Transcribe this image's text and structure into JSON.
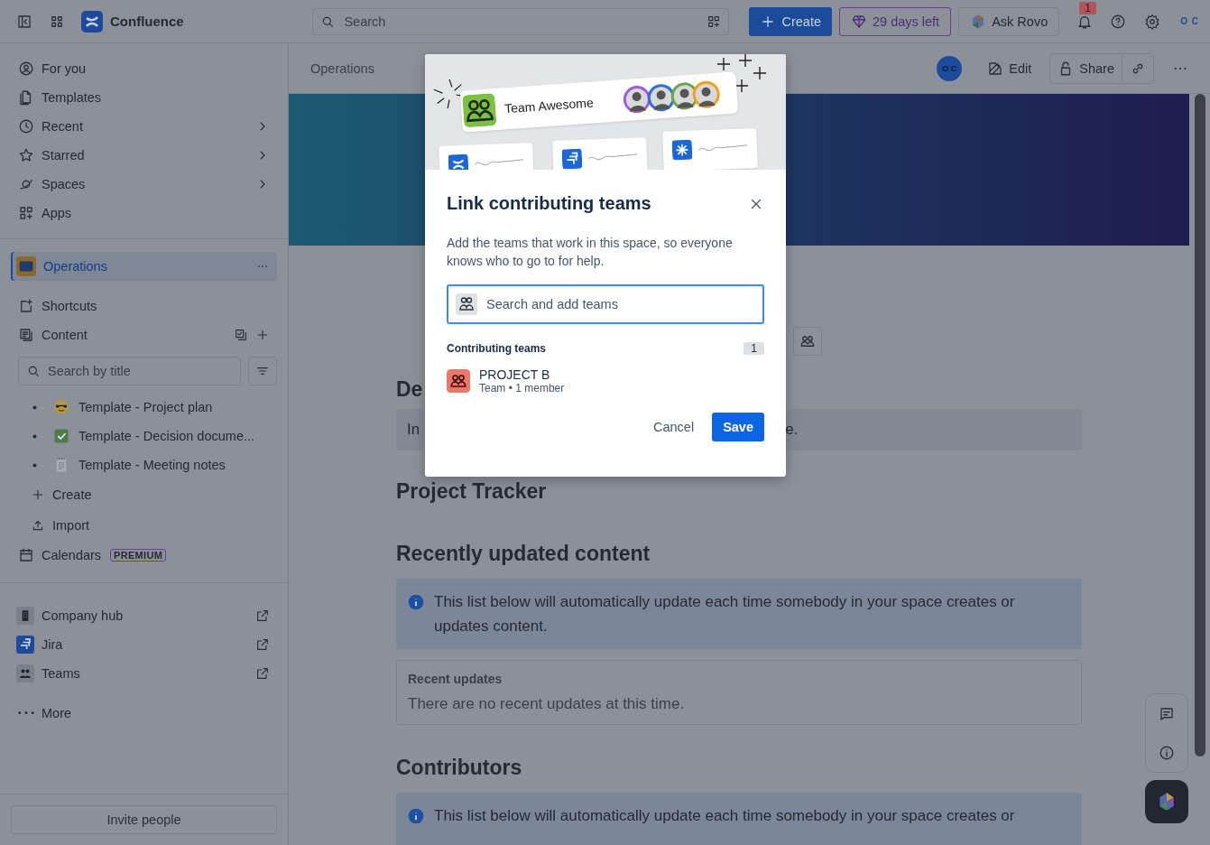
{
  "topbar": {
    "product": "Confluence",
    "search_placeholder": "Search",
    "create": "Create",
    "trial": "29 days left",
    "ask": "Ask Rovo",
    "notifications": "1",
    "avatar": "O C"
  },
  "sidebar": {
    "nav": [
      {
        "label": "For you",
        "chevron": false
      },
      {
        "label": "Templates",
        "chevron": false
      },
      {
        "label": "Recent",
        "chevron": true
      },
      {
        "label": "Starred",
        "chevron": true
      },
      {
        "label": "Spaces",
        "chevron": true
      },
      {
        "label": "Apps",
        "chevron": false
      }
    ],
    "space": {
      "name": "Operations",
      "selected": true
    },
    "sections": [
      "Shortcuts",
      "Content"
    ],
    "content_search_placeholder": "Search by title",
    "pages": [
      {
        "title": "Template - Project plan"
      },
      {
        "title": "Template - Decision docume..."
      },
      {
        "title": "Template - Meeting notes"
      }
    ],
    "actions": [
      "Create",
      "Import"
    ],
    "calendars": {
      "label": "Calendars",
      "badge": "PREMIUM"
    },
    "apps": [
      {
        "label": "Company hub"
      },
      {
        "label": "Jira"
      },
      {
        "label": "Teams"
      }
    ],
    "more": "More",
    "invite": "Invite people"
  },
  "header": {
    "breadcrumb": "Operations",
    "avatar": "O C",
    "edit": "Edit",
    "share": "Share"
  },
  "page": {
    "heading_partial": "De",
    "panel_left": "In",
    "panel_right": "e.",
    "project_tracker": "Project Tracker",
    "recent_heading": "Recently updated content",
    "recent_info": "This list below will automatically update each time somebody in your space creates or updates content.",
    "recent_card_title": "Recent updates",
    "recent_card_text": "There are no recent updates at this time.",
    "contributors_heading": "Contributors",
    "contributors_info": "This list below will automatically update each time somebody in your space creates or"
  },
  "modal": {
    "illustration_team": "Team Awesome",
    "title": "Link contributing teams",
    "description": "Add the teams that work in this space, so everyone knows who to go to for help.",
    "search_placeholder": "Search and add teams",
    "section_label": "Contributing teams",
    "count": "1",
    "teams": [
      {
        "name": "PROJECT B",
        "meta": "Team • 1 member"
      }
    ],
    "cancel": "Cancel",
    "save": "Save"
  }
}
